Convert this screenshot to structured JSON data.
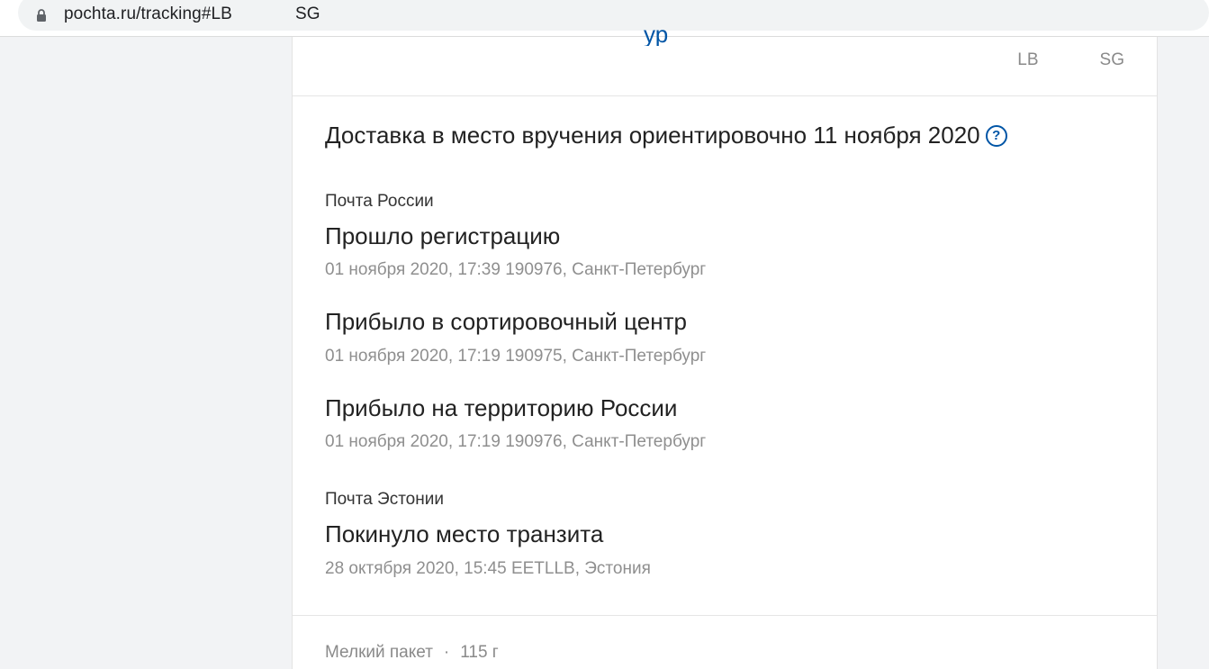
{
  "browser": {
    "url_visible_start": "pochta.ru/tracking#LB",
    "url_visible_end": "SG"
  },
  "header": {
    "blue_title_fragment": "ур",
    "tracking_number_start": "LB",
    "tracking_number_end": "SG"
  },
  "delivery": {
    "text": "Доставка в место вручения ориентировочно 11 ноября 2020",
    "help_icon": "question-circle-icon"
  },
  "groups": [
    {
      "operator": "Почта России",
      "events": [
        {
          "title": "Прошло регистрацию",
          "meta": "01 ноября 2020, 17:39 190976, Санкт-Петербург"
        },
        {
          "title": "Прибыло в сортировочный центр",
          "meta": "01 ноября 2020, 17:19 190975, Санкт-Петербург"
        },
        {
          "title": "Прибыло на территорию России",
          "meta": "01 ноября 2020, 17:19 190976, Санкт-Петербург"
        }
      ]
    },
    {
      "operator": "Почта Эстонии",
      "events": [
        {
          "title": "Покинуло место транзита",
          "meta": "28 октября 2020, 15:45 EETLLB, Эстония"
        }
      ]
    }
  ],
  "package": {
    "type": "Мелкий пакет",
    "separator": "·",
    "weight": "115 г"
  },
  "colors": {
    "accent": "#0055a6",
    "muted": "#8f8f8f",
    "background": "#f2f3f5"
  }
}
